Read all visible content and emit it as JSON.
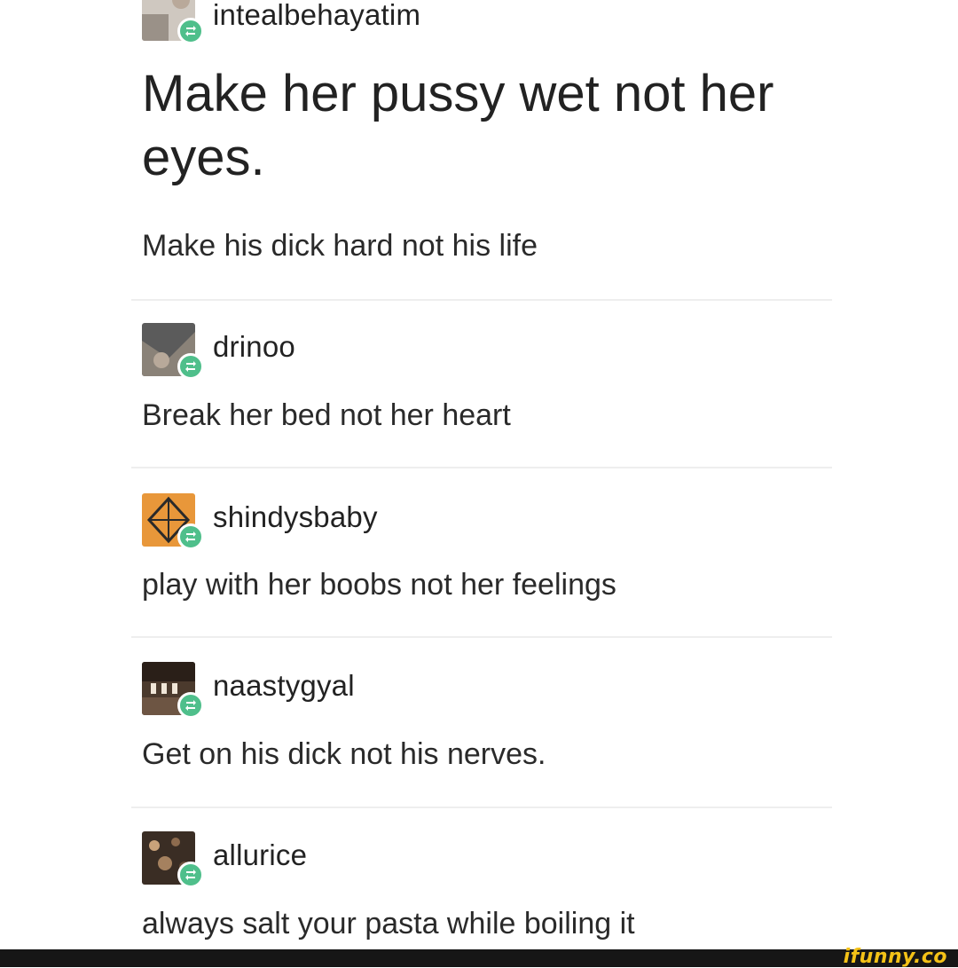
{
  "original_post": {
    "username": "intealbehayatim",
    "headline": "Make her pussy wet not her eyes.",
    "reply": "Make his dick hard not his life"
  },
  "reblogs": [
    {
      "username": "drinoo",
      "text": "Break her bed not her heart",
      "avatar_color": "#6b6b6b"
    },
    {
      "username": "shindysbaby",
      "text": "play with her boobs not her feelings",
      "avatar_color": "#e89a3c"
    },
    {
      "username": "naastygyal",
      "text": "Get on his dick not his nerves.",
      "avatar_color": "#5a4636"
    },
    {
      "username": "allurice",
      "text": "always salt your pasta while boiling it",
      "avatar_color": "#4a3a2e"
    }
  ],
  "watermark": "ifunny.co",
  "colors": {
    "reblog_badge": "#4fbf8b",
    "watermark": "#f4c217",
    "footer_bar": "#161616"
  }
}
